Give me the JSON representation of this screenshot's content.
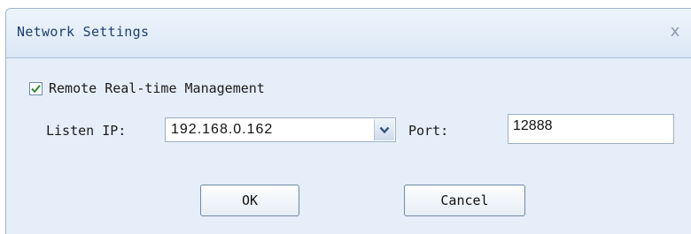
{
  "window": {
    "title": "Network Settings",
    "close_glyph": "x",
    "close_icon": "close-icon"
  },
  "remote": {
    "checked": true,
    "label": "Remote Real-time Management"
  },
  "listen_ip": {
    "label": "Listen IP:",
    "value": "192.168.0.162",
    "dropdown_icon": "chevron-down-icon"
  },
  "port": {
    "label": "Port:",
    "value": "12888"
  },
  "buttons": {
    "ok": "OK",
    "cancel": "Cancel"
  },
  "colors": {
    "title_text": "#1e3f6e",
    "check_mark": "#2e8b2e",
    "dialog_bg": "#e6eef9"
  }
}
